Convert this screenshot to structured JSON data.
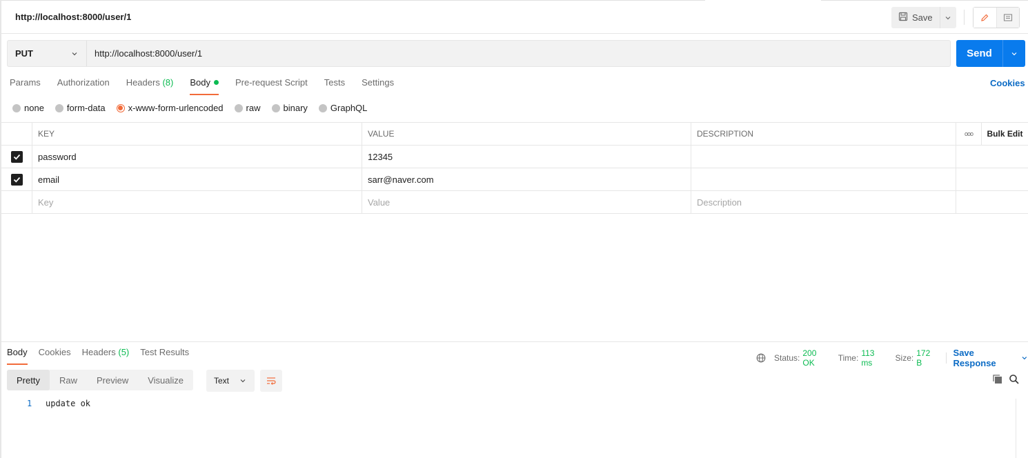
{
  "request": {
    "title": "http://localhost:8000/user/1",
    "method": "PUT",
    "url": "http://localhost:8000/user/1",
    "save_label": "Save",
    "send_label": "Send"
  },
  "request_tabs": [
    {
      "label": "Params"
    },
    {
      "label": "Authorization"
    },
    {
      "label": "Headers",
      "count": "(8)"
    },
    {
      "label": "Body",
      "active": true
    },
    {
      "label": "Pre-request Script"
    },
    {
      "label": "Tests"
    },
    {
      "label": "Settings"
    }
  ],
  "cookies_label": "Cookies",
  "body_types": [
    {
      "label": "none"
    },
    {
      "label": "form-data"
    },
    {
      "label": "x-www-form-urlencoded",
      "selected": true
    },
    {
      "label": "raw"
    },
    {
      "label": "binary"
    },
    {
      "label": "GraphQL"
    }
  ],
  "table": {
    "headers": {
      "key": "KEY",
      "value": "VALUE",
      "description": "DESCRIPTION",
      "more": "ooo",
      "bulk_edit": "Bulk Edit"
    },
    "rows": [
      {
        "key": "password",
        "value": "12345",
        "description": ""
      },
      {
        "key": "email",
        "value": "sarr@naver.com",
        "description": ""
      }
    ],
    "placeholders": {
      "key": "Key",
      "value": "Value",
      "description": "Description"
    }
  },
  "response": {
    "tabs": [
      {
        "label": "Body",
        "active": true
      },
      {
        "label": "Cookies"
      },
      {
        "label": "Headers",
        "count": "(5)"
      },
      {
        "label": "Test Results"
      }
    ],
    "status_label": "Status:",
    "status_value": "200 OK",
    "time_label": "Time:",
    "time_value": "113 ms",
    "size_label": "Size:",
    "size_value": "172 B",
    "save_response_label": "Save Response",
    "view_modes": [
      {
        "label": "Pretty",
        "active": true
      },
      {
        "label": "Raw"
      },
      {
        "label": "Preview"
      },
      {
        "label": "Visualize"
      }
    ],
    "format": "Text",
    "lines": [
      {
        "number": "1",
        "text": "update ok"
      }
    ]
  },
  "colors": {
    "accent": "#f26b3a",
    "send": "#097bed",
    "success": "#0cbb52",
    "link": "#0b6bc5"
  }
}
